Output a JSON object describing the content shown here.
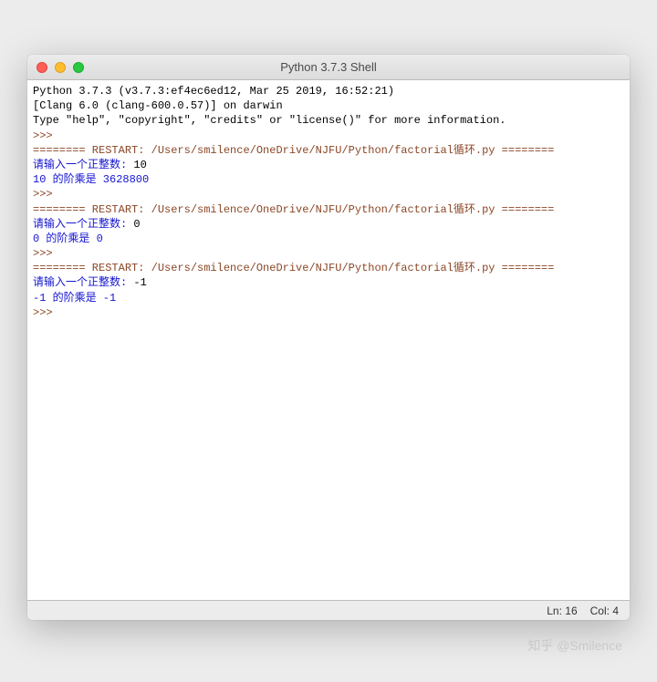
{
  "window": {
    "title": "Python 3.7.3 Shell"
  },
  "content": {
    "header_line1": "Python 3.7.3 (v3.7.3:ef4ec6ed12, Mar 25 2019, 16:52:21)",
    "header_line2": "[Clang 6.0 (clang-600.0.57)] on darwin",
    "header_line3": "Type \"help\", \"copyright\", \"credits\" or \"license()\" for more information.",
    "prompt": ">>> ",
    "restart_label": "======== RESTART: ",
    "restart_path": "/Users/smilence/OneDrive/NJFU/Python/factorial循环.py",
    "restart_tail": " ========",
    "runs": [
      {
        "input_prompt": "请输入一个正整数: ",
        "input_value": "10",
        "output": "10 的阶乘是 3628800"
      },
      {
        "input_prompt": "请输入一个正整数: ",
        "input_value": "0",
        "output": "0 的阶乘是 0"
      },
      {
        "input_prompt": "请输入一个正整数: ",
        "input_value": "-1",
        "output": "-1 的阶乘是 -1"
      }
    ]
  },
  "statusbar": {
    "ln_label": "Ln: ",
    "ln_value": "16",
    "col_label": "Col: ",
    "col_value": "4"
  },
  "watermark": "知乎 @Smilence"
}
